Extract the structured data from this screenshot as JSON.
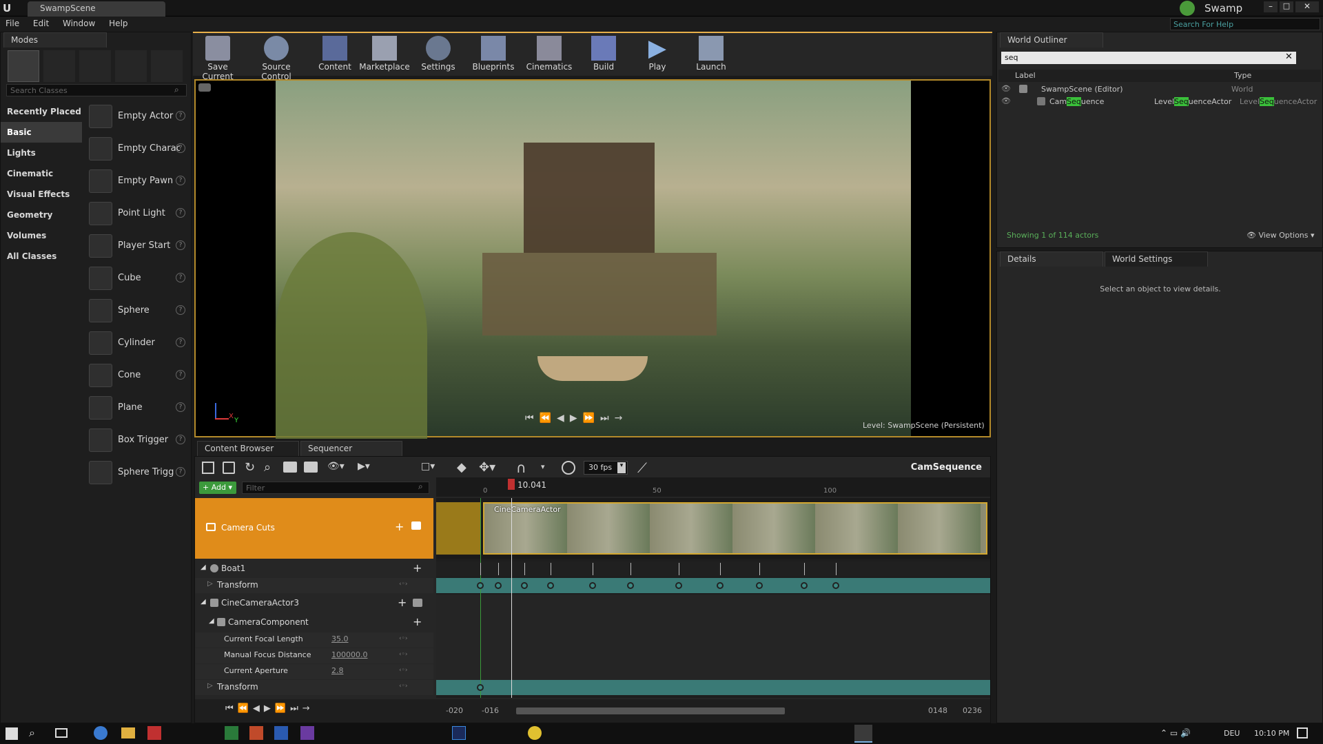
{
  "window": {
    "tab_title": "SwampScene",
    "project_name": "Swamp",
    "search_help_placeholder": "Search For Help"
  },
  "menu": [
    "File",
    "Edit",
    "Window",
    "Help"
  ],
  "modes": {
    "tab_label": "Modes",
    "search_placeholder": "Search Classes",
    "categories": [
      "Recently Placed",
      "Basic",
      "Lights",
      "Cinematic",
      "Visual Effects",
      "Geometry",
      "Volumes",
      "All Classes"
    ],
    "selected_category": "Basic",
    "actors": [
      "Empty Actor",
      "Empty Charac",
      "Empty Pawn",
      "Point Light",
      "Player Start",
      "Cube",
      "Sphere",
      "Cylinder",
      "Cone",
      "Plane",
      "Box Trigger",
      "Sphere Trigg"
    ]
  },
  "toolbar": {
    "buttons": [
      "Save Current",
      "Source Control",
      "Content",
      "Marketplace",
      "Settings",
      "Blueprints",
      "Cinematics",
      "Build",
      "Play",
      "Launch"
    ]
  },
  "viewport": {
    "level_label": "Level:",
    "level_name": "SwampScene (Persistent)",
    "axis_x": "X",
    "axis_y": "Y"
  },
  "outliner": {
    "tab_label": "World Outliner",
    "search_value": "seq",
    "col_label": "Label",
    "col_type": "Type",
    "rows": [
      {
        "label": "SwampScene (Editor)",
        "type": "World"
      },
      {
        "label_pre": "Cam",
        "label_hl": "Seq",
        "label_post": "uence",
        "type_pre": "Level",
        "type_hl": "Seq",
        "type_post": "uenceActor"
      }
    ],
    "status": "Showing 1 of 114 actors",
    "view_options": "View Options"
  },
  "details": {
    "tab_details": "Details",
    "tab_world_settings": "World Settings",
    "empty_msg": "Select an object to view details."
  },
  "bottom_tabs": {
    "content_browser": "Content Browser",
    "sequencer": "Sequencer"
  },
  "sequencer": {
    "fps": "30 fps",
    "sequence_name": "CamSequence",
    "add_label": "Add",
    "filter_placeholder": "Filter",
    "playhead_time": "10.041",
    "ruler": [
      "0",
      "50",
      "100"
    ],
    "camera_cuts": "Camera Cuts",
    "camera_clip_label": "CineCameraActor",
    "tracks": {
      "boat": "Boat1",
      "boat_transform": "Transform",
      "camera_actor": "CineCameraActor3",
      "camera_component": "CameraComponent",
      "focal_length_label": "Current Focal Length",
      "focal_length_value": "35.0",
      "focus_distance_label": "Manual Focus Distance",
      "focus_distance_value": "100000.0",
      "aperture_label": "Current Aperture",
      "aperture_value": "2.8",
      "camera_transform": "Transform"
    },
    "range": {
      "start_outer": "-020",
      "start_inner": "-016",
      "end_inner": "0148",
      "end_outer": "0236"
    }
  },
  "taskbar": {
    "language": "DEU",
    "time": "10:10 PM"
  }
}
